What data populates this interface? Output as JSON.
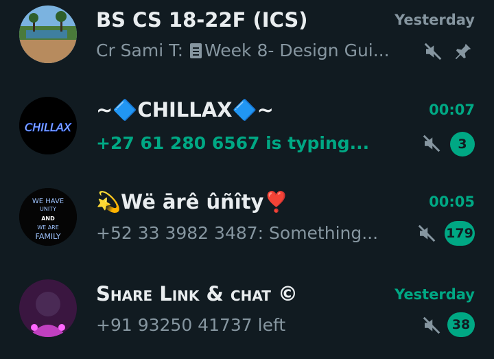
{
  "chats": [
    {
      "title": "BS CS 18-22F (ICS)",
      "time": "Yesterday",
      "time_color": "#8696a0",
      "preview_prefix": "Cr  Sami  T: ",
      "preview_text": "Week 8- Design Gui...",
      "muted": true,
      "pinned": true
    },
    {
      "title": "~🔷CHILLAX🔷~",
      "time": "00:07",
      "time_color": "#00a884",
      "preview_text": "+27 61 280 6567 is typing...",
      "muted": true,
      "unread": "3"
    },
    {
      "title": "💫Wë ārê ûñîty❣️",
      "time": "00:05",
      "time_color": "#00a884",
      "preview_text": "+52 33 3982 3487: Something...",
      "muted": true,
      "unread": "179"
    },
    {
      "title": "Share Link & chat ©",
      "time": "Yesterday",
      "time_color": "#00a884",
      "preview_text": "+91 93250 41737 left",
      "muted": true,
      "unread": "38"
    }
  ],
  "avatar_text": {
    "chillax": "CHILLAX",
    "unity_top": "WE HAVE",
    "unity_mid": "UNITY",
    "unity_and": "AND",
    "unity_we_are": "WE ARE",
    "unity_family": "FAMILY"
  }
}
